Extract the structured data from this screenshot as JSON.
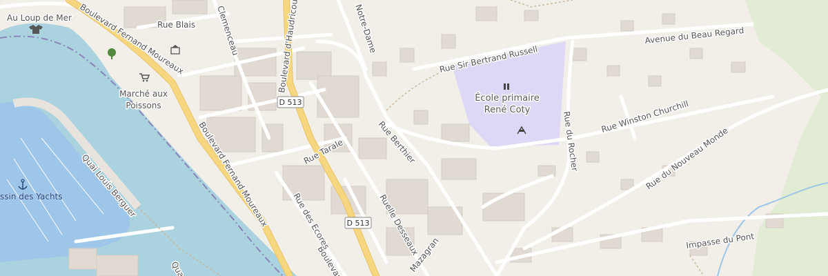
{
  "map": {
    "colors": {
      "background": "#f2efe9",
      "water": "#aad3df",
      "water_deep": "#9dc6e8",
      "school": "#dcd8f5",
      "building": "#e0dad3",
      "road_minor": "#ffffff",
      "road_primary": "#f6d67e",
      "park": "#cdebb0",
      "label": "#555555"
    },
    "streets": {
      "boulevard_moureaux_1": "Boulevard Fernand Moureaux",
      "boulevard_moureaux_2": "Boulevard Fernand Moureaux",
      "boulevard_moureaux_3": "Boulevard",
      "clemenceau": "Clemenceau",
      "rue_blais": "Rue Blais",
      "boulevard_haudricourt": "Boulevard d'Haudricourt",
      "notre_dame": "Notre-Dame",
      "sir_bertrand_russell": "Rue Sir Bertrand Russell",
      "beau_regard": "Avenue du Beau Regard",
      "winston_churchill": "Rue Winston Churchill",
      "rocher": "Rue du Rocher",
      "nouveau_monde": "Rue du Nouveau Monde",
      "berthier": "Rue Berthier",
      "tarale": "Rue Tarale",
      "ecores": "Rue des Ecores",
      "desseaux": "Ruelle Desseaux",
      "mazagran": "Mazagran",
      "quai_berguer": "Quai Louis Berguer",
      "impasse_pont": "Impasse du Pont",
      "quai_short": "Qua"
    },
    "pois": {
      "restaurant": "Au Loup de Mer",
      "market_line1": "Marché aux",
      "market_line2": "Poissons",
      "school_line1": "École primaire",
      "school_line2": "René Coty",
      "marina": "ssin des Yachts"
    },
    "road_shields": {
      "d513_top": "D 513",
      "d513_bottom": "D 513"
    },
    "icons": [
      "tshirt-icon",
      "tree-icon",
      "shopping-cart-icon",
      "police-icon",
      "school-icon",
      "playground-icon",
      "anchor-icon"
    ]
  }
}
